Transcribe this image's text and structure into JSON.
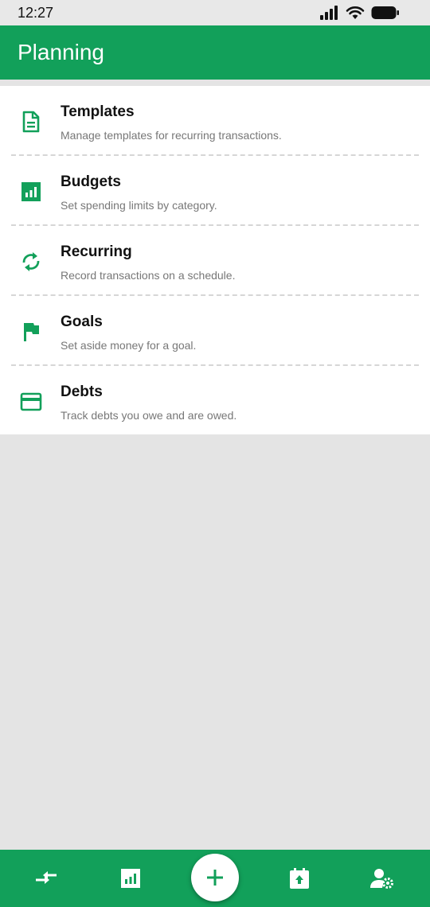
{
  "status_bar": {
    "time": "12:27"
  },
  "header": {
    "title": "Planning"
  },
  "colors": {
    "primary": "#12a05a",
    "background": "#e4e4e4"
  },
  "items": [
    {
      "title": "Templates",
      "subtitle": "Manage templates for recurring transactions.",
      "icon": "document-icon"
    },
    {
      "title": "Budgets",
      "subtitle": "Set spending limits by category.",
      "icon": "bar-chart-icon"
    },
    {
      "title": "Recurring",
      "subtitle": "Record transactions on a schedule.",
      "icon": "refresh-icon"
    },
    {
      "title": "Goals",
      "subtitle": "Set aside money for a goal.",
      "icon": "flag-icon"
    },
    {
      "title": "Debts",
      "subtitle": "Track debts you owe and are owed.",
      "icon": "credit-card-icon"
    }
  ],
  "bottom_nav": {
    "items": [
      "transfer-icon",
      "bar-chart-icon",
      "add-icon",
      "calendar-upload-icon",
      "user-settings-icon"
    ]
  }
}
